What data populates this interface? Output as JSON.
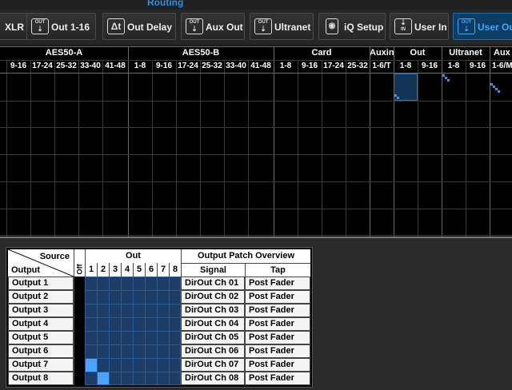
{
  "title": "Routing",
  "tabs": [
    {
      "label": "XLR",
      "icon": "xlr-icon",
      "active": false
    },
    {
      "label": "Out 1-16",
      "icon": "out-icon",
      "active": false
    },
    {
      "label": "Out Delay",
      "icon": "delay-icon",
      "active": false
    },
    {
      "label": "Aux Out",
      "icon": "out-icon",
      "active": false
    },
    {
      "label": "Ultranet",
      "icon": "out-icon",
      "active": false
    },
    {
      "label": "iQ Setup",
      "icon": "speaker-icon",
      "active": false
    },
    {
      "label": "User In",
      "icon": "in-icon",
      "active": false
    },
    {
      "label": "User Out",
      "icon": "out-icon",
      "active": true
    }
  ],
  "icon_text": {
    "out": "OUT",
    "in": "IN"
  },
  "matrix": {
    "groups": [
      {
        "label": "AES50-A",
        "subs": [
          "9-16",
          "17-24",
          "25-32",
          "33-40",
          "41-48"
        ]
      },
      {
        "label": "AES50-B",
        "subs": [
          "1-8",
          "9-16",
          "17-24",
          "25-32",
          "33-40",
          "41-48"
        ]
      },
      {
        "label": "Card",
        "subs": [
          "1-8",
          "9-16",
          "17-24",
          "25-32"
        ]
      },
      {
        "label": "Auxin",
        "subs": [
          "1-6/T"
        ]
      },
      {
        "label": "Out",
        "subs": [
          "1-8",
          "9-16"
        ]
      },
      {
        "label": "Ultranet",
        "subs": [
          "1-8",
          "9-16"
        ]
      },
      {
        "label": "Aux",
        "subs": [
          "1-6/M"
        ]
      }
    ]
  },
  "overview": {
    "source_label": "Source",
    "output_label": "Output",
    "off_label": "Off",
    "out_label": "Out",
    "columns": [
      "1",
      "2",
      "3",
      "4",
      "5",
      "6",
      "7",
      "8"
    ],
    "patch_title": "Output  Patch Overview",
    "signal_header": "Signal",
    "tap_header": "Tap",
    "rows": [
      {
        "output": "Output 1",
        "signal": "DirOut Ch 01",
        "tap": "Post Fader",
        "patched_col": null
      },
      {
        "output": "Output 2",
        "signal": "DirOut Ch 02",
        "tap": "Post Fader",
        "patched_col": null
      },
      {
        "output": "Output 3",
        "signal": "DirOut Ch 03",
        "tap": "Post Fader",
        "patched_col": null
      },
      {
        "output": "Output 4",
        "signal": "DirOut Ch 04",
        "tap": "Post Fader",
        "patched_col": null
      },
      {
        "output": "Output 5",
        "signal": "DirOut Ch 05",
        "tap": "Post Fader",
        "patched_col": null
      },
      {
        "output": "Output 6",
        "signal": "DirOut Ch 06",
        "tap": "Post Fader",
        "patched_col": null
      },
      {
        "output": "Output 7",
        "signal": "DirOut Ch 07",
        "tap": "Post Fader",
        "patched_col": 1
      },
      {
        "output": "Output 8",
        "signal": "DirOut Ch 08",
        "tap": "Post Fader",
        "patched_col": 2
      }
    ]
  },
  "colors": {
    "accent": "#3fa3ff",
    "patch": "#4aa3ff",
    "grid": "#1c3d66"
  }
}
